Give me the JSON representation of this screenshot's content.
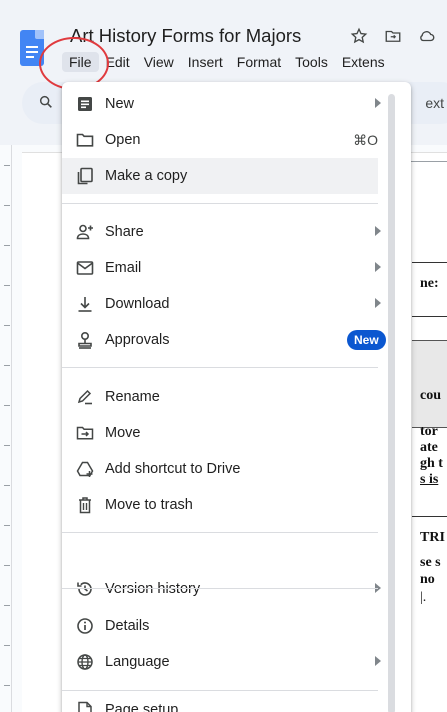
{
  "header": {
    "title": "Art History Forms for Majors",
    "menus": [
      "File",
      "Edit",
      "View",
      "Insert",
      "Format",
      "Tools",
      "Extens"
    ],
    "icons": [
      "star-icon",
      "move-to-folder-icon",
      "cloud-status-icon"
    ]
  },
  "toolbar": {
    "search_icon": "search-icon",
    "text_fragment": "ext"
  },
  "document": {
    "fragments": [
      "ne:",
      "cou",
      "tor",
      "ate",
      "gh t",
      "s is",
      "TRI",
      "se s",
      "no",
      "|."
    ]
  },
  "file_menu": {
    "items": [
      {
        "label": "New",
        "icon": "new-document-icon",
        "submenu": true
      },
      {
        "label": "Open",
        "icon": "folder-icon",
        "shortcut": "⌘O"
      },
      {
        "label": "Make a copy",
        "icon": "copy-icon",
        "highlighted": true
      },
      {
        "label": "Share",
        "icon": "person-add-icon",
        "submenu": true
      },
      {
        "label": "Email",
        "icon": "email-icon",
        "submenu": true
      },
      {
        "label": "Download",
        "icon": "download-icon",
        "submenu": true
      },
      {
        "label": "Approvals",
        "icon": "approvals-icon",
        "badge": "New"
      },
      {
        "label": "Rename",
        "icon": "rename-icon"
      },
      {
        "label": "Move",
        "icon": "move-icon"
      },
      {
        "label": "Add shortcut to Drive",
        "icon": "add-shortcut-icon"
      },
      {
        "label": "Move to trash",
        "icon": "trash-icon"
      },
      {
        "label": "Version history",
        "icon": "history-icon",
        "submenu": true
      },
      {
        "label": "Details",
        "icon": "info-icon"
      },
      {
        "label": "Language",
        "icon": "globe-icon",
        "submenu": true
      },
      {
        "label": "Page setup",
        "icon": "page-setup-icon"
      }
    ]
  },
  "colors": {
    "badge": "#0b57d0",
    "annotation": "#e03a3e",
    "docs_blue": "#4285f4"
  }
}
